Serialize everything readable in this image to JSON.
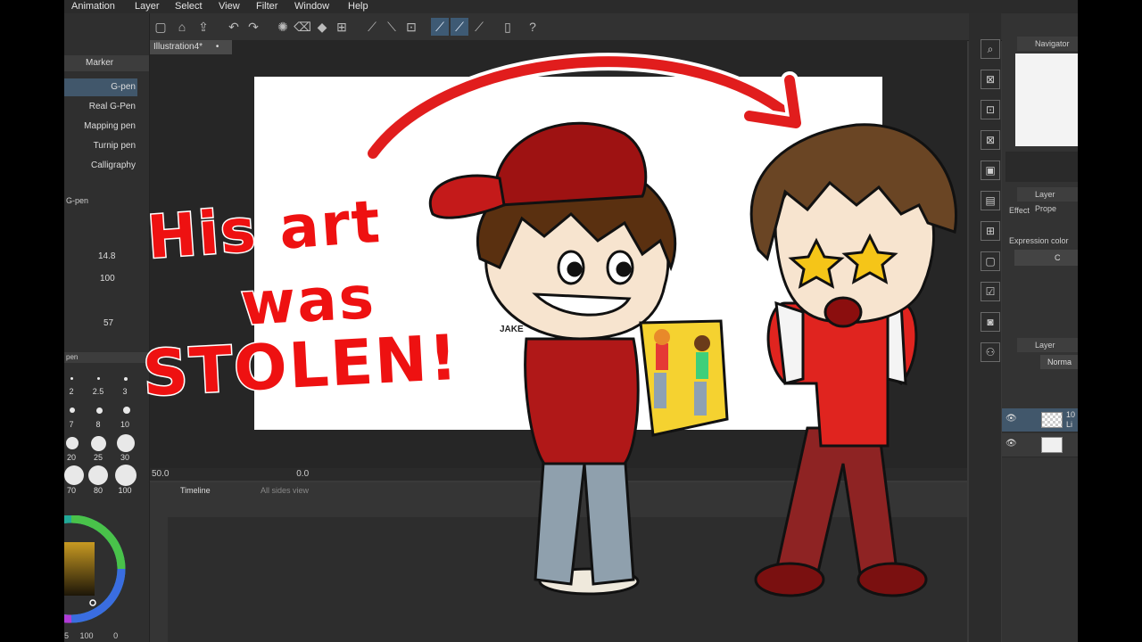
{
  "menu": [
    "Animation",
    "Layer",
    "Select",
    "View",
    "Filter",
    "Window",
    "Help"
  ],
  "document_tab": "Illustration4*",
  "tool_panel": {
    "title": "Marker",
    "brushes": [
      "G-pen",
      "Real G-Pen",
      "Mapping pen",
      "Turnip pen",
      "Calligraphy"
    ],
    "selected_brush": "G-pen",
    "subtool_title": "G-pen",
    "brush_size": "14.8",
    "opacity": "100",
    "hardness": "57"
  },
  "brush_sizes": {
    "title": "pen",
    "rows": [
      [
        "2",
        "2.5",
        "3"
      ],
      [
        "7",
        "8",
        "10"
      ],
      [
        "20",
        "25",
        "30"
      ],
      [
        "70",
        "80",
        "100"
      ]
    ]
  },
  "color_footer": {
    "a": "5",
    "b": "100",
    "c": "0"
  },
  "status": {
    "zoom": "50.0",
    "angle": "0.0"
  },
  "timeline": {
    "title": "Timeline",
    "tab2": "All sides view"
  },
  "navigator": {
    "title": "Navigator"
  },
  "layer_property": {
    "title": "Layer Prope",
    "effect": "Effect",
    "expression_color": "Expression color",
    "expression_value": "C"
  },
  "layers": {
    "title": "Layer",
    "blend_mode": "Norma",
    "layer1_label": "10",
    "layer1_sub": "Li"
  },
  "overlay_text": {
    "line1": "His art",
    "line2": "was",
    "line3": "STOLEN!"
  },
  "signature": "JAKE",
  "colors": {
    "accent": "#e11d1d",
    "selection": "#41576b",
    "panel": "#2f2f2f"
  }
}
